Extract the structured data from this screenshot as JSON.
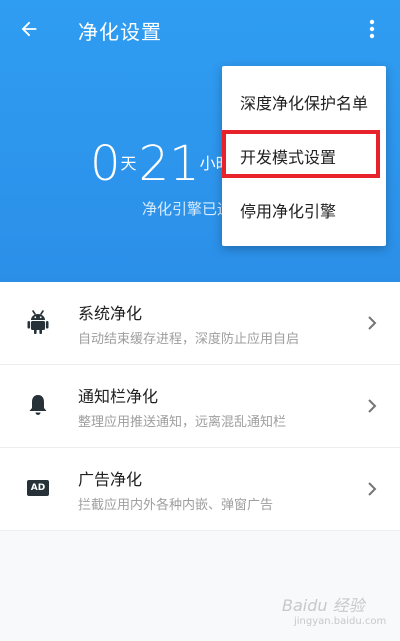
{
  "header": {
    "title": "净化设置",
    "counter": {
      "days": "0",
      "days_unit": "天",
      "hours": "21",
      "hours_unit": "小时"
    },
    "subtext": "净化引擎已运行"
  },
  "menu": {
    "items": [
      {
        "label": "深度净化保护名单"
      },
      {
        "label": "开发模式设置"
      },
      {
        "label": "停用净化引擎"
      }
    ]
  },
  "list": {
    "items": [
      {
        "title": "系统净化",
        "subtitle": "自动结束缓存进程，深度防止应用自启",
        "icon": "android-icon"
      },
      {
        "title": "通知栏净化",
        "subtitle": "整理应用推送通知，远离混乱通知栏",
        "icon": "bell-icon"
      },
      {
        "title": "广告净化",
        "subtitle": "拦截应用内外各种内嵌、弹窗广告",
        "icon": "ad-icon",
        "badge": "AD"
      }
    ]
  },
  "watermark": {
    "text": "Baidu 经验",
    "url": "jingyan.baidu.com"
  },
  "colors": {
    "header_blue": "#2f9df2",
    "highlight_red": "#e8222b"
  }
}
